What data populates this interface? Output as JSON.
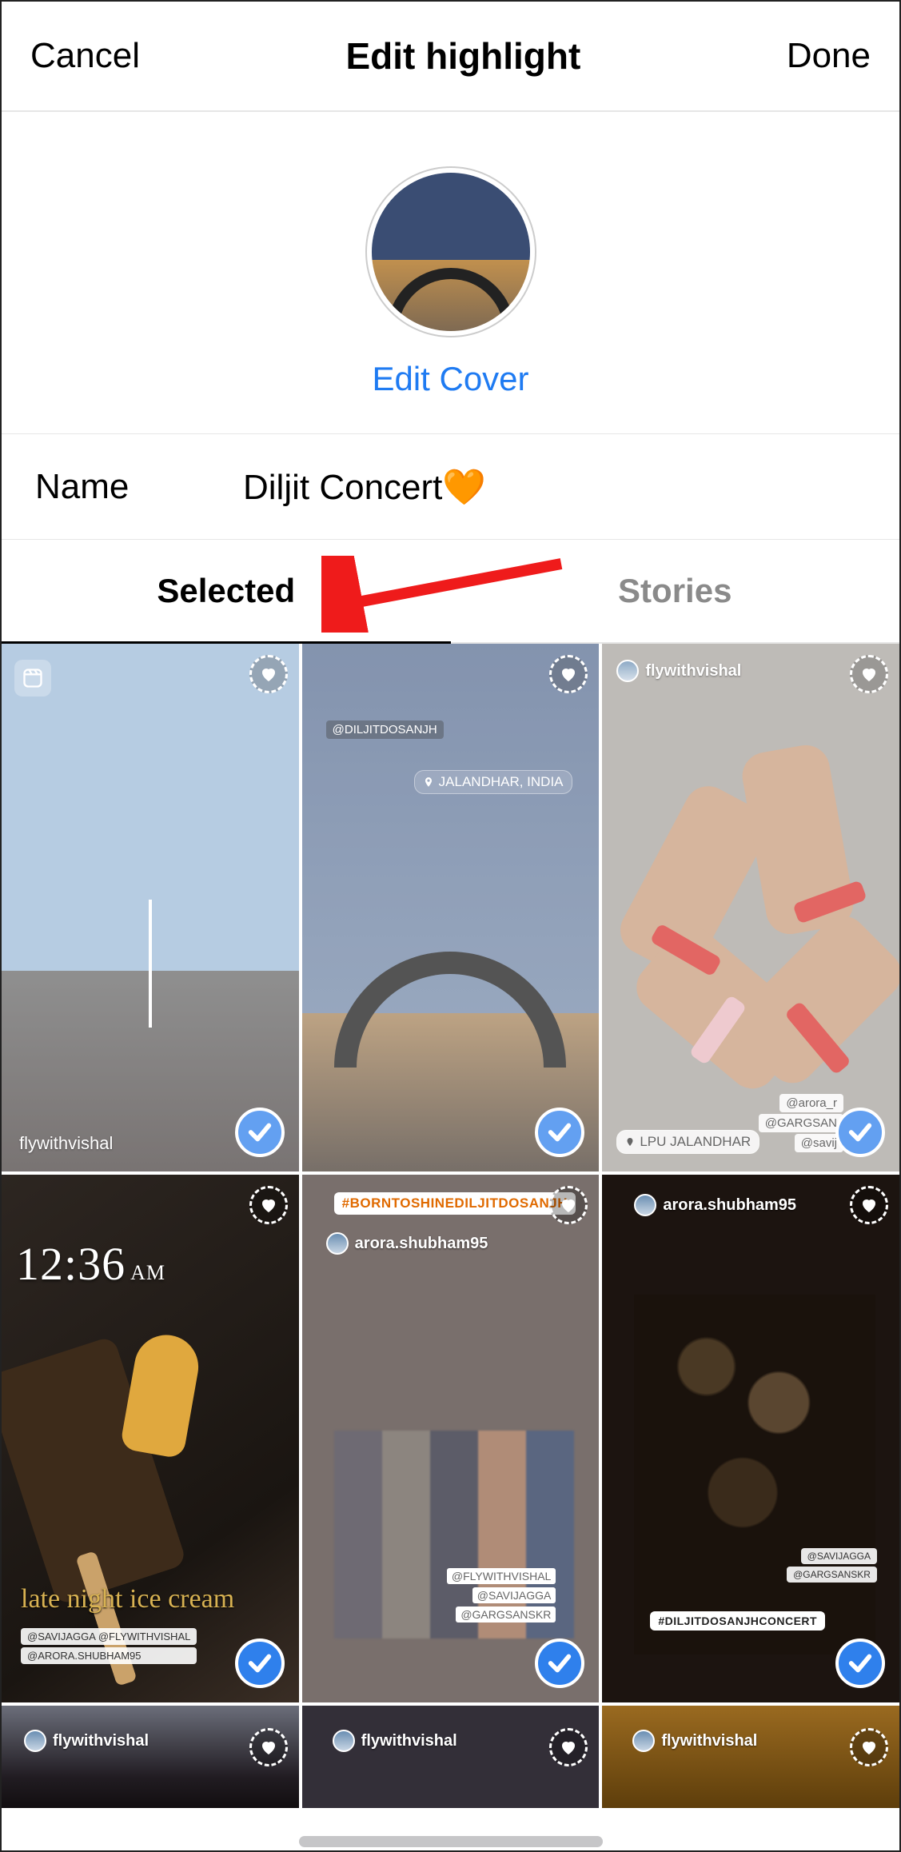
{
  "header": {
    "cancel_label": "Cancel",
    "title": "Edit highlight",
    "done_label": "Done"
  },
  "cover": {
    "edit_label": "Edit Cover"
  },
  "name_row": {
    "label": "Name",
    "value": "Diljit Concert🧡"
  },
  "tabs": {
    "selected_label": "Selected",
    "stories_label": "Stories",
    "active": "selected"
  },
  "grid": [
    {
      "id": "cell-0",
      "selected": true,
      "has_reel_icon": true,
      "watermark": "flywithvishal"
    },
    {
      "id": "cell-1",
      "selected": true,
      "mention": "@DILJITDOSANJH",
      "location": "JALANDHAR, INDIA"
    },
    {
      "id": "cell-2",
      "selected": true,
      "user_header": "flywithvishal",
      "location_footer": "LPU JALANDHAR",
      "footer_tags": [
        "@arora_r",
        "@GARGSAN",
        "@savij"
      ]
    },
    {
      "id": "cell-3",
      "selected": true,
      "time": "12:36",
      "ampm": "AM",
      "script_caption": "late night ice cream",
      "footer_tags": [
        "@SAVIJAGGA @FLYWITHVISHAL",
        "@ARORA.SHUBHAM95"
      ]
    },
    {
      "id": "cell-4",
      "selected": true,
      "hashtag": "#BORNTOSHINEDILJITDOSANJH",
      "user_header": "arora.shubham95",
      "footer_tags": [
        "@FLYWITHVISHAL",
        "@SAVIJAGGA",
        "@GARGSANSKR"
      ]
    },
    {
      "id": "cell-5",
      "selected": true,
      "user_header": "arora.shubham95",
      "hashtag_footer": "#DILJITDOSANJHCONCERT",
      "footer_tags": [
        "@SAVIJAGGA",
        "@GARGSANSKR"
      ]
    },
    {
      "id": "cell-6",
      "selected": false,
      "user_header": "flywithvishal"
    },
    {
      "id": "cell-7",
      "selected": false,
      "user_header": "flywithvishal"
    },
    {
      "id": "cell-8",
      "selected": false,
      "user_header": "flywithvishal"
    }
  ]
}
